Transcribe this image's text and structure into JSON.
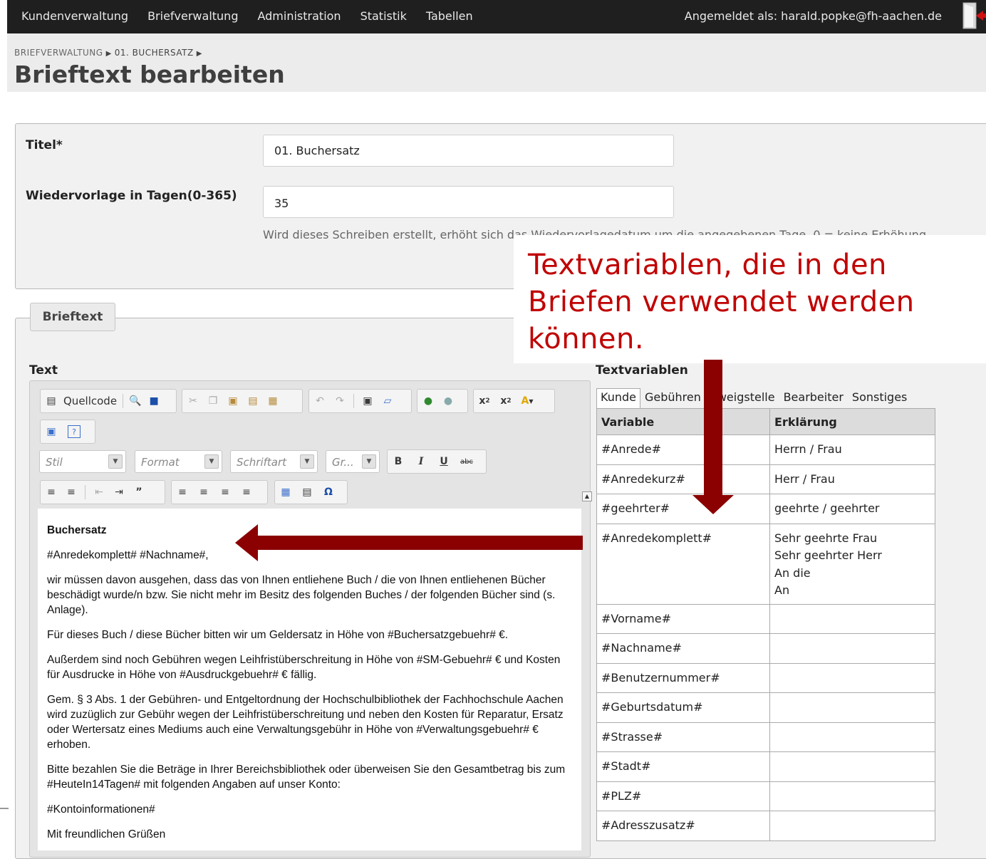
{
  "nav": {
    "items": [
      "Kundenverwaltung",
      "Briefverwaltung",
      "Administration",
      "Statistik",
      "Tabellen"
    ],
    "user": "Angemeldet als: harald.popke@fh-aachen.de"
  },
  "breadcrumb": {
    "item1": "BRIEFVERWALTUNG",
    "item2": "01. BUCHERSATZ"
  },
  "page_title": "Brieftext bearbeiten",
  "form": {
    "titel_label": "Titel*",
    "titel_value": "01. Buchersatz",
    "wv_label": "Wiedervorlage in Tagen(0-365)",
    "wv_value": "35",
    "wv_hint": "Wird dieses Schreiben erstellt, erhöht sich das Wiedervorlagedatum um die angegebenen Tage. 0 = keine Erhöhung"
  },
  "section": {
    "legend": "Brieftext",
    "text_label": "Text",
    "vars_label": "Textvariablen"
  },
  "editor": {
    "source_label": "Quellcode",
    "combos": {
      "stil": "Stil",
      "format": "Format",
      "font": "Schriftart",
      "size": "Gr..."
    },
    "doc": {
      "heading": "Buchersatz",
      "paragraphs": [
        "#Anredekomplett# #Nachname#,",
        "wir müssen davon ausgehen, dass das von Ihnen entliehene Buch / die von Ihnen entliehenen Bücher beschädigt wurde/n bzw. Sie nicht mehr im Besitz des folgenden Buches / der folgenden Bücher sind (s. Anlage).",
        "Für dieses Buch / diese Bücher bitten wir um Geldersatz in Höhe von #Buchersatzgebuehr# €.",
        "Außerdem sind noch Gebühren wegen Leihfristüberschreitung in Höhe von #SM-Gebuehr# € und Kosten für Ausdrucke in Höhe von #Ausdruckgebuehr# € fällig.",
        "Gem. § 3 Abs. 1 der Gebühren- und Entgeltordnung der Hochschulbibliothek der Fachhochschule Aachen wird zuzüglich zur Gebühr wegen der Leihfristüberschreitung und neben den Kosten für Reparatur, Ersatz oder Wertersatz eines Mediums auch eine Verwaltungsgebühr in Höhe von #Verwaltungsgebuehr# € erhoben.",
        "Bitte bezahlen Sie die Beträge in Ihrer Bereichsbibliothek oder überweisen Sie den Gesamtbetrag bis zum #HeuteIn14Tagen# mit folgenden Angaben auf unser Konto:",
        "#Kontoinformationen#",
        "Mit freundlichen Grüßen"
      ]
    }
  },
  "variables": {
    "tabs": [
      "Kunde",
      "Gebühren",
      "Zweigstelle",
      "Bearbeiter",
      "Sonstiges"
    ],
    "headers": [
      "Variable",
      "Erklärung"
    ],
    "rows": [
      {
        "var": "#Anrede#",
        "desc": "Herrn / Frau"
      },
      {
        "var": "#Anredekurz#",
        "desc": "Herr / Frau"
      },
      {
        "var": "#geehrter#",
        "desc": "geehrte / geehrter"
      },
      {
        "var": "#Anredekomplett#",
        "desc": "Sehr geehrte Frau\nSehr geehrter Herr\nAn die\nAn"
      },
      {
        "var": "#Vorname#",
        "desc": ""
      },
      {
        "var": "#Nachname#",
        "desc": ""
      },
      {
        "var": "#Benutzernummer#",
        "desc": ""
      },
      {
        "var": "#Geburtsdatum#",
        "desc": ""
      },
      {
        "var": "#Strasse#",
        "desc": ""
      },
      {
        "var": "#Stadt#",
        "desc": ""
      },
      {
        "var": "#PLZ#",
        "desc": ""
      },
      {
        "var": "#Adresszusatz#",
        "desc": ""
      }
    ]
  },
  "annotation": {
    "text": "Textvariablen, die in den Briefen verwendet werden können.",
    "color": "#c00000",
    "arrow_color": "#8b0000"
  },
  "colors": {
    "nav_bg": "#1f1f1f",
    "panel_bg": "#f1f1f1"
  },
  "icons": [
    "source-icon",
    "preview-icon",
    "save-icon",
    "cut-icon",
    "copy-icon",
    "paste-icon",
    "paste-text-icon",
    "paste-word-icon",
    "undo-icon",
    "redo-icon",
    "select-all-icon",
    "remove-format-icon",
    "spellcheck-icon",
    "anchor-icon",
    "subscript-icon",
    "superscript-icon",
    "text-color-icon",
    "maximize-icon",
    "help-icon",
    "bold-icon",
    "italic-icon",
    "underline-icon",
    "strike-icon",
    "numbered-list-icon",
    "bullet-list-icon",
    "outdent-icon",
    "indent-icon",
    "blockquote-icon",
    "align-left-icon",
    "align-center-icon",
    "align-right-icon",
    "justify-icon",
    "table-icon",
    "hr-icon",
    "omega-icon",
    "exit-icon"
  ]
}
